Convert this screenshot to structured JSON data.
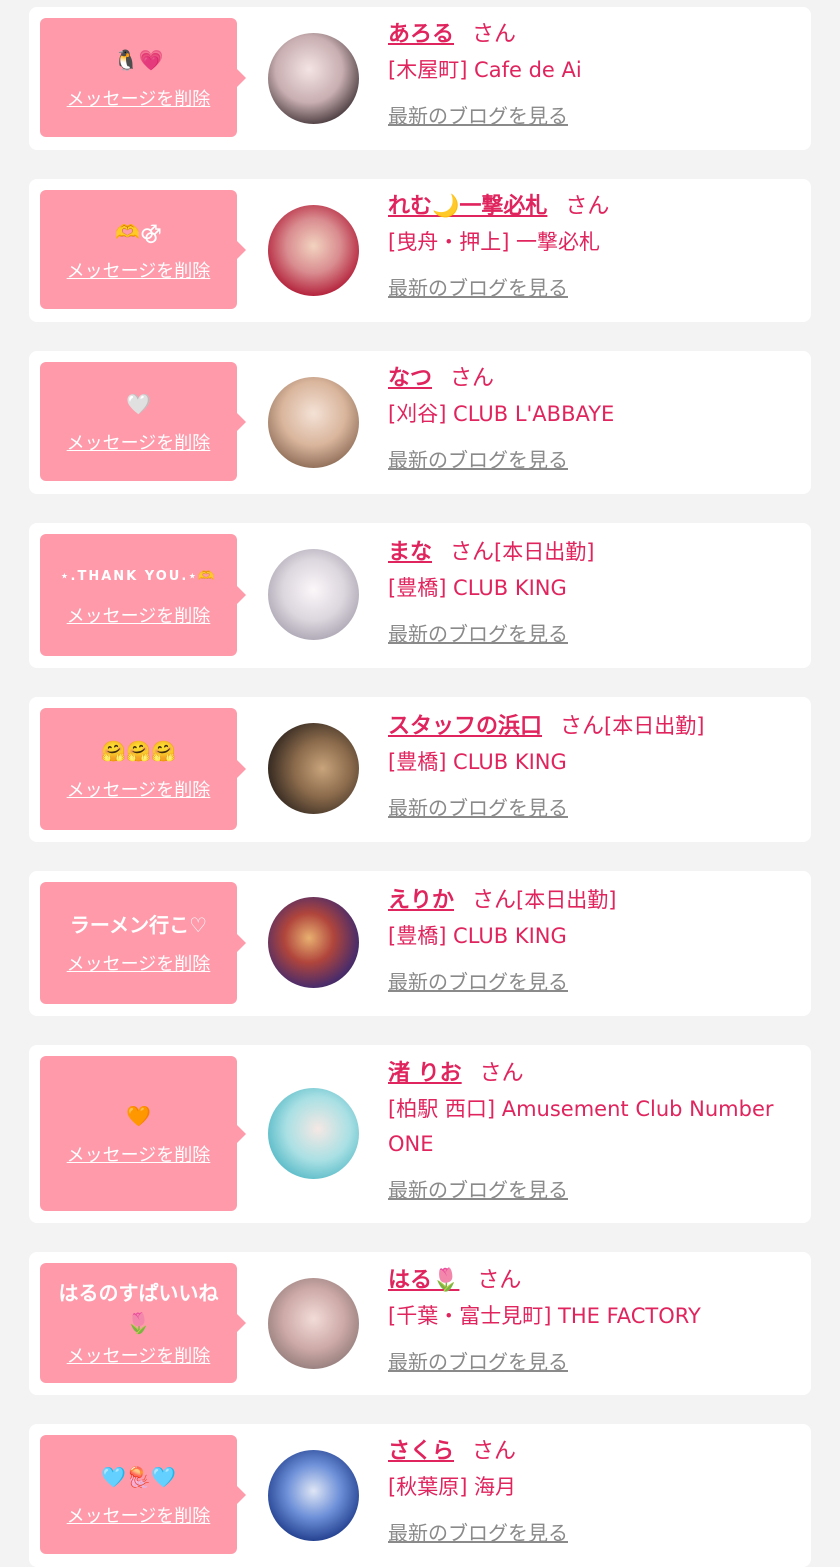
{
  "cards": [
    {
      "message": "🐧💗",
      "delete_label": "メッセージを削除",
      "name": "あろる",
      "honorific": "さん",
      "status": "",
      "shop": "[木屋町] Cafe de Ai",
      "blog_label": "最新のブログを見る"
    },
    {
      "message": "🫶⚣",
      "delete_label": "メッセージを削除",
      "name": "れむ🌙一撃必札",
      "honorific": "さん",
      "status": "",
      "shop": "[曳舟・押上] 一撃必札",
      "blog_label": "最新のブログを見る"
    },
    {
      "message": "🤍",
      "delete_label": "メッセージを削除",
      "name": "なつ",
      "honorific": "さん",
      "status": "",
      "shop": "[刈谷] CLUB L'ABBAYE",
      "blog_label": "最新のブログを見る"
    },
    {
      "message": "⋆.THANK YOU.⋆🫶",
      "delete_label": "メッセージを削除",
      "name": "まな",
      "honorific": "さん",
      "status": "[本日出勤]",
      "shop": "[豊橋] CLUB KING",
      "blog_label": "最新のブログを見る"
    },
    {
      "message": "🤗🤗🤗",
      "delete_label": "メッセージを削除",
      "name": "スタッフの浜口",
      "honorific": "さん",
      "status": "[本日出勤]",
      "shop": "[豊橋] CLUB KING",
      "blog_label": "最新のブログを見る"
    },
    {
      "message": "ラーメン行こ♡",
      "delete_label": "メッセージを削除",
      "name": "えりか",
      "honorific": "さん",
      "status": "[本日出勤]",
      "shop": "[豊橋] CLUB KING",
      "blog_label": "最新のブログを見る"
    },
    {
      "message": "🧡",
      "delete_label": "メッセージを削除",
      "name": "渚 りお",
      "honorific": "さん",
      "status": "",
      "shop": "[柏駅 西口] Amusement Club Number ONE",
      "blog_label": "最新のブログを見る"
    },
    {
      "message": "はるのすぱいいね\n🌷",
      "delete_label": "メッセージを削除",
      "name": "はる🌷",
      "honorific": "さん",
      "status": "",
      "shop": "[千葉・富士見町] THE FACTORY",
      "blog_label": "最新のブログを見る"
    },
    {
      "message": "🩵🪼🩵",
      "delete_label": "メッセージを削除",
      "name": "さくら",
      "honorific": "さん",
      "status": "",
      "shop": "[秋葉原] 海月",
      "blog_label": "最新のブログを見る"
    }
  ]
}
